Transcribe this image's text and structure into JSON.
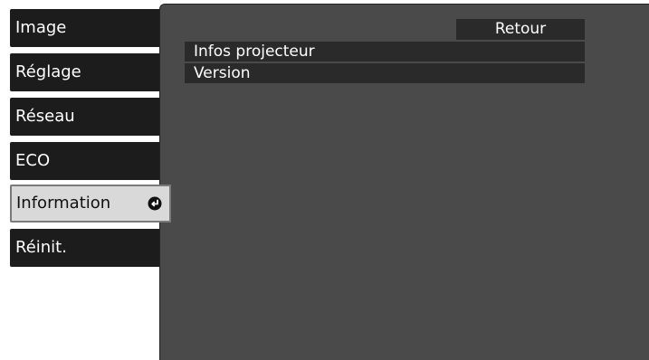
{
  "menu": {
    "items": [
      {
        "label": "Image"
      },
      {
        "label": "Réglage"
      },
      {
        "label": "Réseau"
      },
      {
        "label": "ECO"
      },
      {
        "label": "Information",
        "selected": true
      },
      {
        "label": "Réinit."
      }
    ]
  },
  "submenu": {
    "back_label": "Retour",
    "items": [
      {
        "label": "Infos projecteur"
      },
      {
        "label": "Version"
      }
    ]
  },
  "icons": {
    "enter": "enter-arrow-icon"
  },
  "colors": {
    "menu_bg": "#1c1c1c",
    "menu_selected_bg": "#d9d9d9",
    "panel_bg": "#4a4a4a",
    "item_bg": "#2a2a2a",
    "text": "#ffffff"
  }
}
